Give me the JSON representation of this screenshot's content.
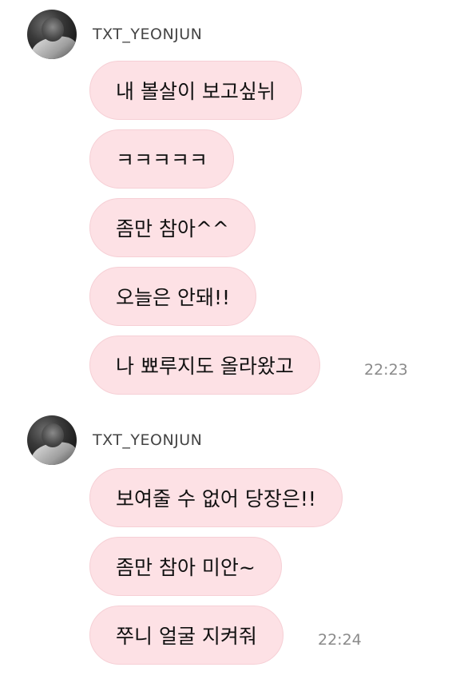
{
  "groups": [
    {
      "username": "TXT_YEONJUN",
      "avatar_icon": "profile-photo",
      "messages": [
        "내 볼살이 보고싶뉘",
        "ㅋㅋㅋㅋㅋ",
        "좀만 참아^^",
        "오늘은 안돼!!",
        "나 뾰루지도 올라왔고"
      ],
      "time": "22:23"
    },
    {
      "username": "TXT_YEONJUN",
      "avatar_icon": "profile-photo",
      "messages": [
        "보여줄 수 없어 당장은!!",
        "좀만 참아 미안~",
        "쭈니 얼굴 지켜줘"
      ],
      "time": "22:24"
    }
  ],
  "colors": {
    "bubble_bg": "#fde1e5",
    "bubble_border": "#f6cfd5",
    "username": "#444444",
    "time": "#8a8a8a"
  }
}
